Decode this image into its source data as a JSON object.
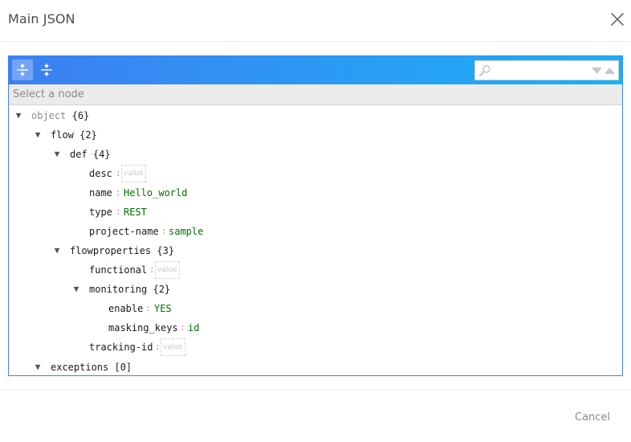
{
  "modal": {
    "title": "Main JSON",
    "close_icon": "close-icon",
    "cancel_label": "Cancel"
  },
  "menu": {
    "expand_all_icon": "expand-all-icon",
    "collapse_all_icon": "collapse-all-icon",
    "search_placeholder": "",
    "accent_start": "#3d7ff2",
    "accent_end": "#15b2f6"
  },
  "navbar": {
    "text": "Select a node"
  },
  "tree": {
    "root": {
      "key": "object",
      "count": "{6}"
    },
    "flow": {
      "key": "flow",
      "count": "{2}"
    },
    "def": {
      "key": "def",
      "count": "{4}"
    },
    "desc": {
      "key": "desc",
      "value": "value"
    },
    "name": {
      "key": "name",
      "value": "Hello_world"
    },
    "type": {
      "key": "type",
      "value": "REST"
    },
    "project_name": {
      "key": "project-name",
      "value": "sample"
    },
    "flowproperties": {
      "key": "flowproperties",
      "count": "{3}"
    },
    "functional": {
      "key": "functional",
      "value": "value"
    },
    "monitoring": {
      "key": "monitoring",
      "count": "{2}"
    },
    "enable": {
      "key": "enable",
      "value": "YES"
    },
    "masking_keys": {
      "key": "masking_keys",
      "value": "id"
    },
    "tracking_id": {
      "key": "tracking-id",
      "value": "value"
    },
    "exceptions": {
      "key": "exceptions",
      "count": "[0]"
    },
    "separator": ":",
    "toggle_glyph": "▼",
    "string_color": "#007000"
  }
}
